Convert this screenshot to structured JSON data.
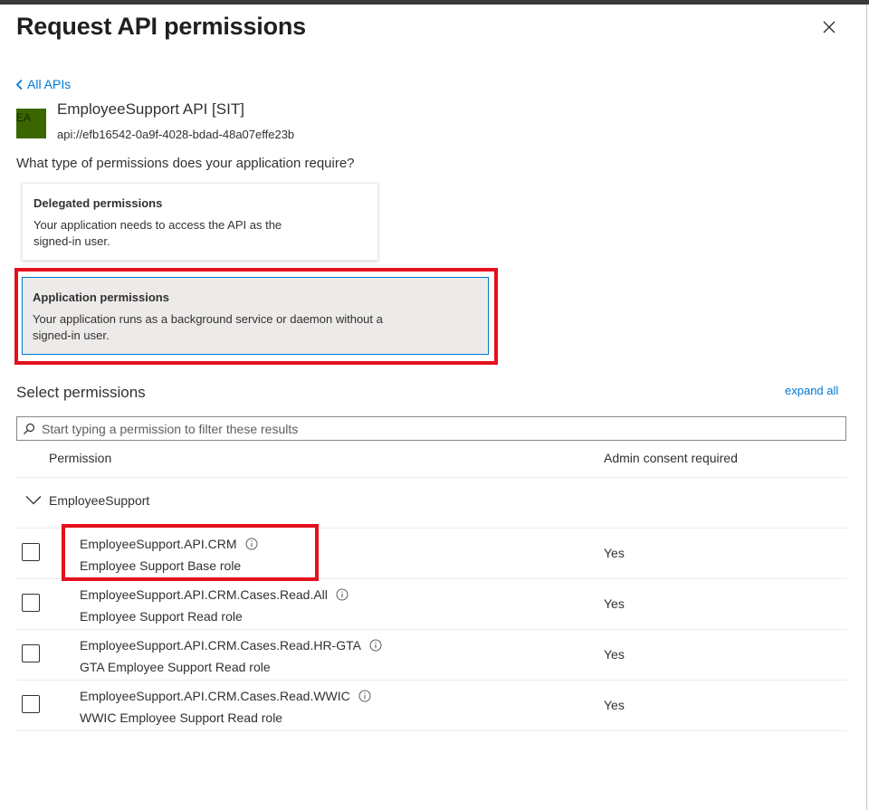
{
  "panel": {
    "title": "Request API permissions",
    "close_icon": "close-icon"
  },
  "nav": {
    "back_label": "All APIs"
  },
  "api": {
    "avatar_text": "EA",
    "avatar_color": "#3a6600",
    "name": "EmployeeSupport API [SIT]",
    "uri": "api://efb16542-0a9f-4028-bdad-48a07effe23b"
  },
  "question": "What type of permissions does your application require?",
  "permission_types": [
    {
      "title": "Delegated permissions",
      "description": "Your application needs to access the API as the signed-in user.",
      "selected": false
    },
    {
      "title": "Application permissions",
      "description": "Your application runs as a background service or daemon without a signed-in user.",
      "selected": true
    }
  ],
  "select_permissions": {
    "title": "Select permissions",
    "expand_all_label": "expand all",
    "search_placeholder": "Start typing a permission to filter these results",
    "columns": {
      "permission": "Permission",
      "admin_consent": "Admin consent required"
    },
    "groups": [
      {
        "label": "EmployeeSupport",
        "expanded": true,
        "permissions": [
          {
            "name": "EmployeeSupport.API.CRM",
            "description": "Employee Support Base role",
            "admin_consent": "Yes",
            "checked": false
          },
          {
            "name": "EmployeeSupport.API.CRM.Cases.Read.All",
            "description": "Employee Support Read role",
            "admin_consent": "Yes",
            "checked": false
          },
          {
            "name": "EmployeeSupport.API.CRM.Cases.Read.HR-GTA",
            "description": "GTA Employee Support Read role",
            "admin_consent": "Yes",
            "checked": false
          },
          {
            "name": "EmployeeSupport.API.CRM.Cases.Read.WWIC",
            "description": "WWIC Employee Support Read role",
            "admin_consent": "Yes",
            "checked": false
          }
        ]
      }
    ]
  },
  "colors": {
    "accent": "#0078d4",
    "highlight_annotation": "#e5101d",
    "selected_card_bg": "#edebe9"
  }
}
